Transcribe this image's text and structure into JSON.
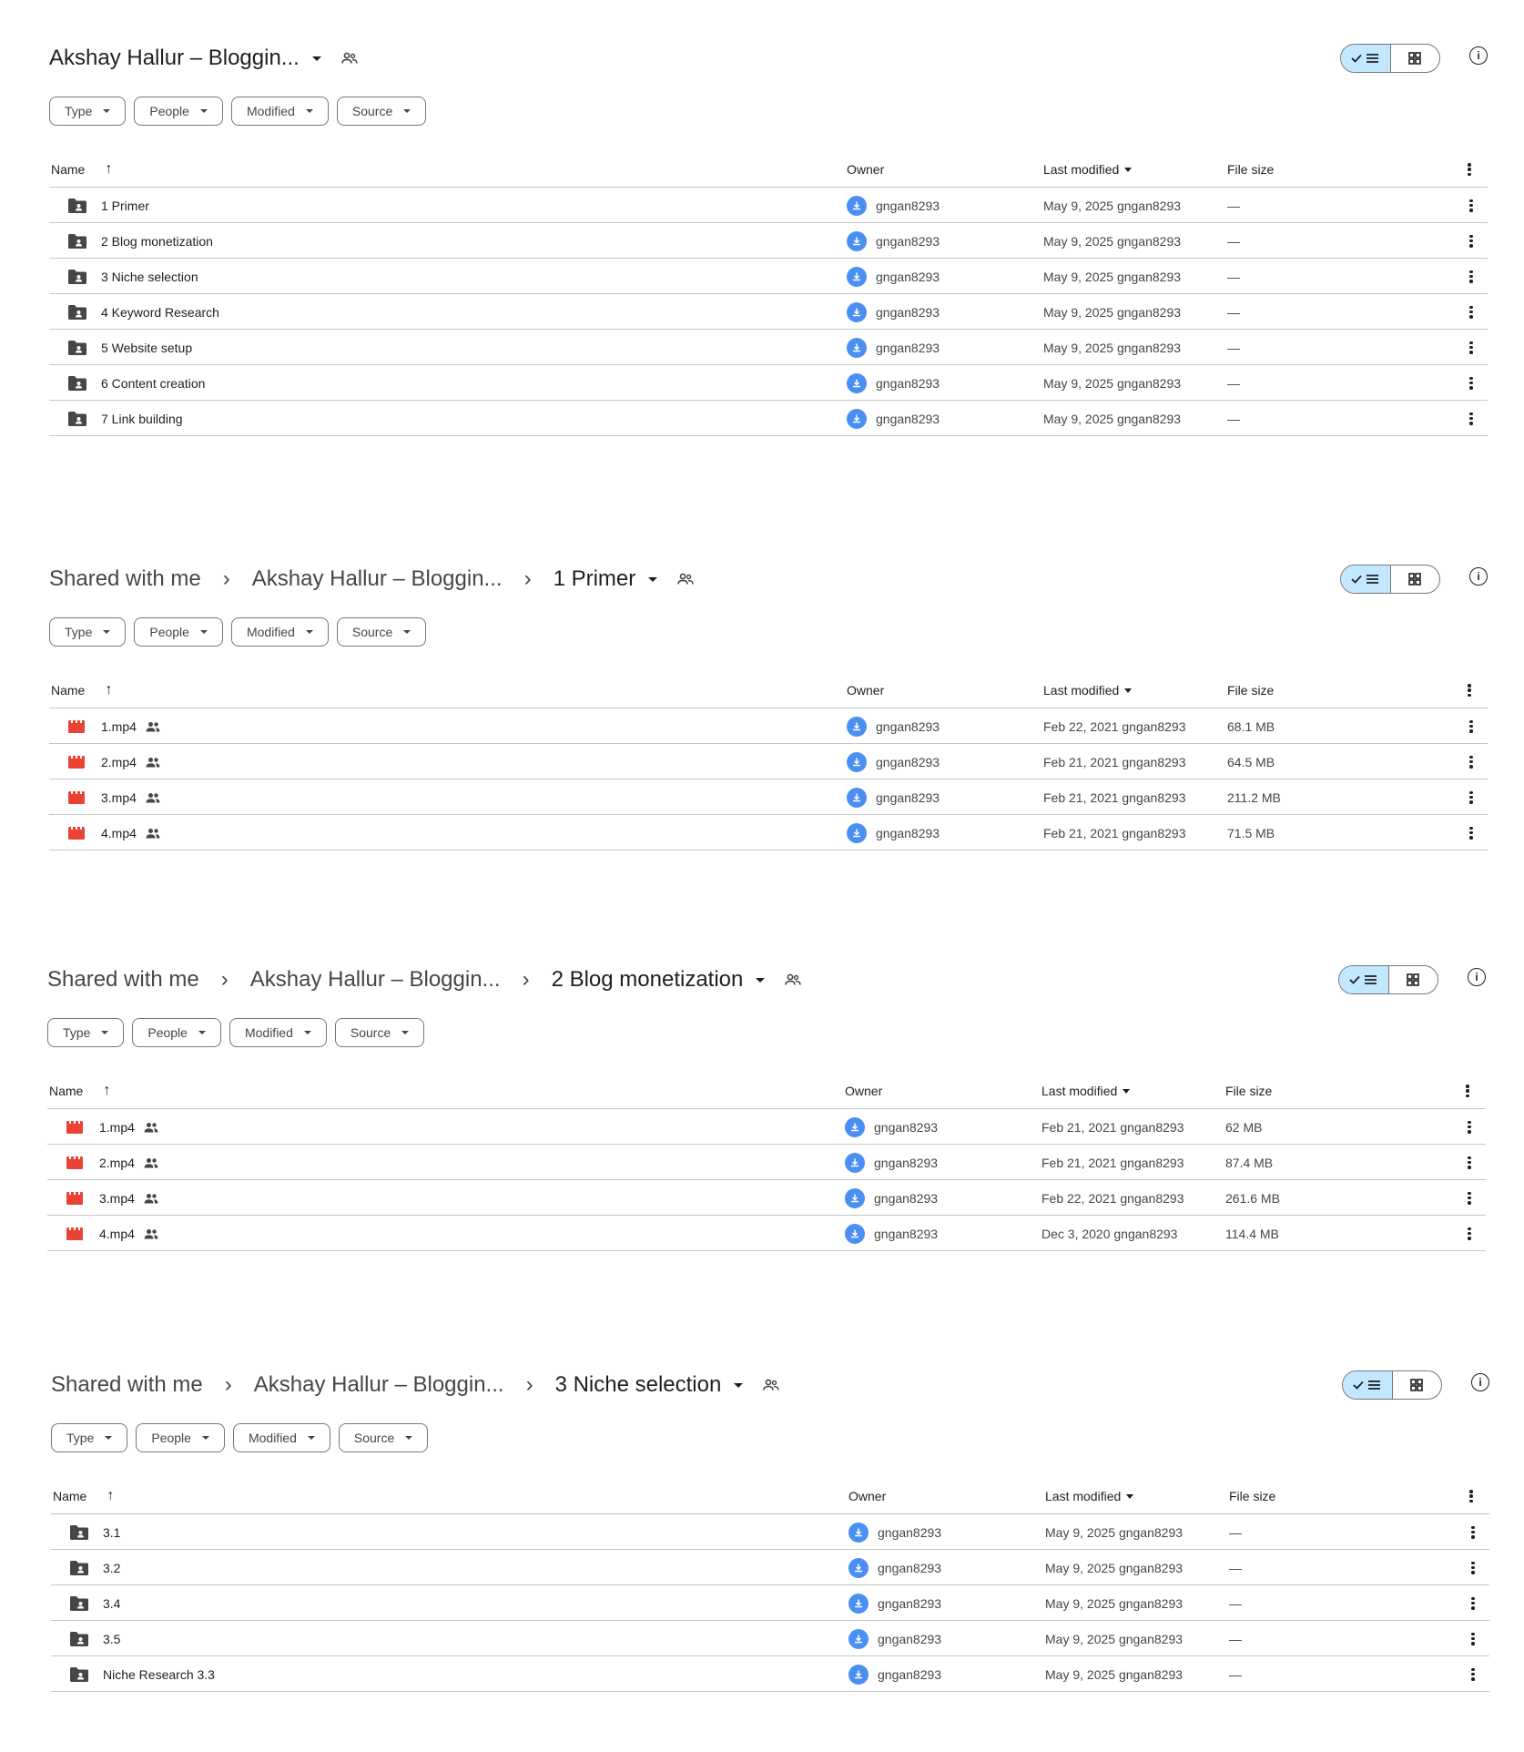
{
  "colors": {
    "accent": "#c2e7ff",
    "video_icon": "#ea4335",
    "folder_icon": "#444746",
    "avatar": "#4b8ff3"
  },
  "filters": [
    "Type",
    "People",
    "Modified",
    "Source"
  ],
  "columns": {
    "name": "Name",
    "owner": "Owner",
    "modified": "Last modified",
    "size": "File size"
  },
  "panels": [
    {
      "breadcrumbs": [],
      "current": "Akshay Hallur – Bloggin...",
      "rows": [
        {
          "icon": "shared-folder-icon",
          "name": "1 Primer",
          "owner": "gngan8293",
          "modified": "May 9, 2025 gngan8293",
          "size": "—",
          "shared": false
        },
        {
          "icon": "shared-folder-icon",
          "name": "2 Blog monetization",
          "owner": "gngan8293",
          "modified": "May 9, 2025 gngan8293",
          "size": "—",
          "shared": false
        },
        {
          "icon": "shared-folder-icon",
          "name": "3 Niche selection",
          "owner": "gngan8293",
          "modified": "May 9, 2025 gngan8293",
          "size": "—",
          "shared": false
        },
        {
          "icon": "shared-folder-icon",
          "name": "4 Keyword Research",
          "owner": "gngan8293",
          "modified": "May 9, 2025 gngan8293",
          "size": "—",
          "shared": false
        },
        {
          "icon": "shared-folder-icon",
          "name": "5 Website setup",
          "owner": "gngan8293",
          "modified": "May 9, 2025 gngan8293",
          "size": "—",
          "shared": false
        },
        {
          "icon": "shared-folder-icon",
          "name": "6 Content creation",
          "owner": "gngan8293",
          "modified": "May 9, 2025 gngan8293",
          "size": "—",
          "shared": false
        },
        {
          "icon": "shared-folder-icon",
          "name": "7 Link building",
          "owner": "gngan8293",
          "modified": "May 9, 2025 gngan8293",
          "size": "—",
          "shared": false
        }
      ]
    },
    {
      "breadcrumbs": [
        "Shared with me",
        "Akshay Hallur – Bloggin..."
      ],
      "current": "1 Primer",
      "rows": [
        {
          "icon": "video-file-icon",
          "name": "1.mp4",
          "owner": "gngan8293",
          "modified": "Feb 22, 2021 gngan8293",
          "size": "68.1 MB",
          "shared": true
        },
        {
          "icon": "video-file-icon",
          "name": "2.mp4",
          "owner": "gngan8293",
          "modified": "Feb 21, 2021 gngan8293",
          "size": "64.5 MB",
          "shared": true
        },
        {
          "icon": "video-file-icon",
          "name": "3.mp4",
          "owner": "gngan8293",
          "modified": "Feb 21, 2021 gngan8293",
          "size": "211.2 MB",
          "shared": true
        },
        {
          "icon": "video-file-icon",
          "name": "4.mp4",
          "owner": "gngan8293",
          "modified": "Feb 21, 2021 gngan8293",
          "size": "71.5 MB",
          "shared": true
        }
      ]
    },
    {
      "breadcrumbs": [
        "Shared with me",
        "Akshay Hallur – Bloggin..."
      ],
      "current": "2 Blog monetization",
      "rows": [
        {
          "icon": "video-file-icon",
          "name": "1.mp4",
          "owner": "gngan8293",
          "modified": "Feb 21, 2021 gngan8293",
          "size": "62 MB",
          "shared": true
        },
        {
          "icon": "video-file-icon",
          "name": "2.mp4",
          "owner": "gngan8293",
          "modified": "Feb 21, 2021 gngan8293",
          "size": "87.4 MB",
          "shared": true
        },
        {
          "icon": "video-file-icon",
          "name": "3.mp4",
          "owner": "gngan8293",
          "modified": "Feb 22, 2021 gngan8293",
          "size": "261.6 MB",
          "shared": true
        },
        {
          "icon": "video-file-icon",
          "name": "4.mp4",
          "owner": "gngan8293",
          "modified": "Dec 3, 2020 gngan8293",
          "size": "114.4 MB",
          "shared": true
        }
      ]
    },
    {
      "breadcrumbs": [
        "Shared with me",
        "Akshay Hallur – Bloggin..."
      ],
      "current": "3 Niche selection",
      "rows": [
        {
          "icon": "shared-folder-icon",
          "name": "3.1",
          "owner": "gngan8293",
          "modified": "May 9, 2025 gngan8293",
          "size": "—",
          "shared": false
        },
        {
          "icon": "shared-folder-icon",
          "name": "3.2",
          "owner": "gngan8293",
          "modified": "May 9, 2025 gngan8293",
          "size": "—",
          "shared": false
        },
        {
          "icon": "shared-folder-icon",
          "name": "3.4",
          "owner": "gngan8293",
          "modified": "May 9, 2025 gngan8293",
          "size": "—",
          "shared": false
        },
        {
          "icon": "shared-folder-icon",
          "name": "3.5",
          "owner": "gngan8293",
          "modified": "May 9, 2025 gngan8293",
          "size": "—",
          "shared": false
        },
        {
          "icon": "shared-folder-icon",
          "name": "Niche Research 3.3",
          "owner": "gngan8293",
          "modified": "May 9, 2025 gngan8293",
          "size": "—",
          "shared": false
        }
      ]
    }
  ]
}
